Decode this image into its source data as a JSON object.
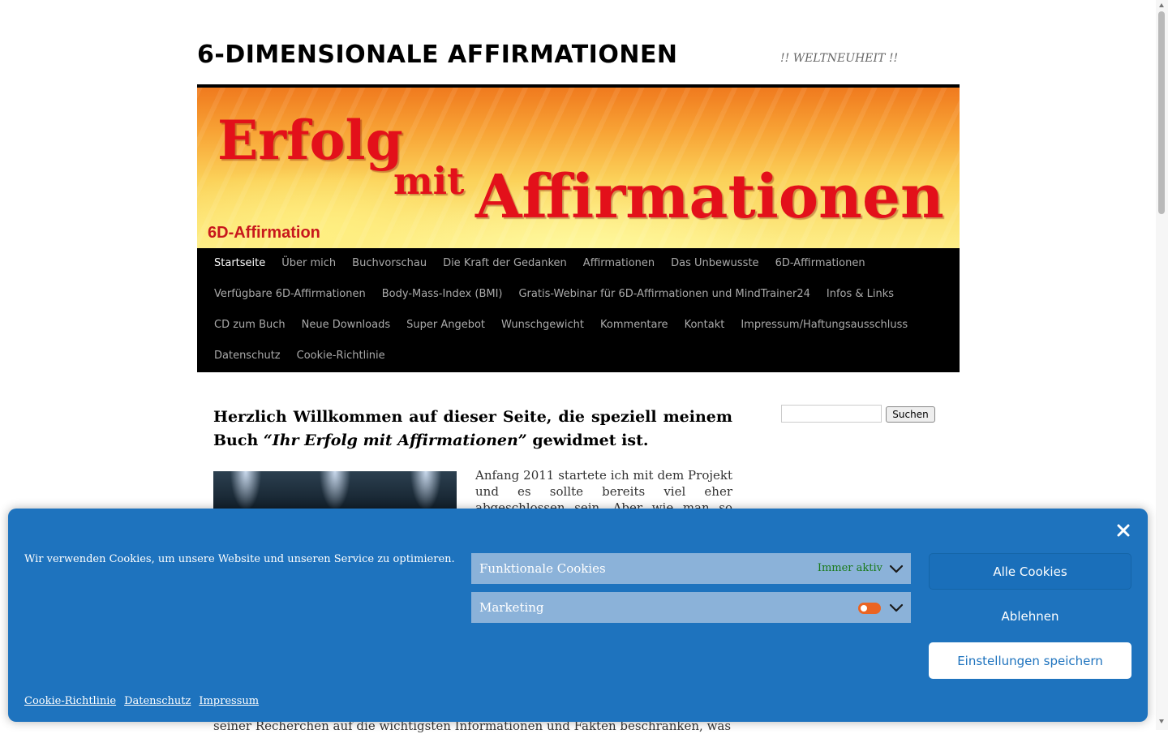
{
  "site": {
    "title": "6-DIMENSIONALE AFFIRMATIONEN",
    "description": "!! WELTNEUHEIT !!"
  },
  "banner": {
    "line1": "Erfolg",
    "line2": "mit",
    "line3": "Affirmationen",
    "subtitle": "6D-Affirmation",
    "colors": {
      "text": "#e3101a",
      "background_top": "#f07a1e",
      "background_bottom": "#fdee88"
    }
  },
  "nav": {
    "rows": [
      [
        "Startseite",
        "Über mich",
        "Buchvorschau",
        "Die Kraft der Gedanken",
        "Affirmationen",
        "Das Unbewusste",
        "6D-Affirmationen"
      ],
      [
        "Verfügbare 6D-Affirmationen",
        "Body-Mass-Index (BMI)",
        "Gratis-Webinar für 6D-Affirmationen und MindTrainer24",
        "Infos & Links"
      ],
      [
        "CD zum Buch",
        "Neue Downloads",
        "Super Angebot",
        "Wunschgewicht",
        "Kommentare",
        "Kontakt",
        "Impressum/Haftungsausschluss"
      ],
      [
        "Datenschutz",
        "Cookie-Richtlinie"
      ]
    ],
    "current": "Startseite"
  },
  "content": {
    "heading_part1": "Herzlich Willkommen auf dieser Seite, die speziell meinem Buch ",
    "heading_em": "“Ihr Erfolg mit Affirmationen”",
    "heading_part2": " gewidmet ist.",
    "paragraph_top": "Anfang 2011 startete ich mit dem Projekt und es sollte bereits viel eher abgeschlossen sein. Aber wie man so schön",
    "paragraph_bottom": "seiner Recherchen auf die wichtigsten Informationen und Fakten beschränken, was"
  },
  "sidebar": {
    "search_placeholder": "",
    "search_button": "Suchen"
  },
  "cookie": {
    "message": "Wir verwenden Cookies, um unsere Website und unseren Service zu optimieren.",
    "categories": [
      {
        "title": "Funktionale Cookies",
        "status": "Immer aktiv"
      },
      {
        "title": "Marketing",
        "enabled": false
      }
    ],
    "buttons": {
      "accept": "Alle Cookies",
      "deny": "Ablehnen",
      "save": "Einstellungen speichern"
    },
    "links": [
      "Cookie-Richtlinie",
      "Datenschutz",
      "Impressum"
    ],
    "colors": {
      "banner": "#1e73be",
      "category": "#8bb2d9",
      "toggle": "#eb6422",
      "status": "#1a7a1a"
    },
    "close_icon": "close-icon"
  }
}
